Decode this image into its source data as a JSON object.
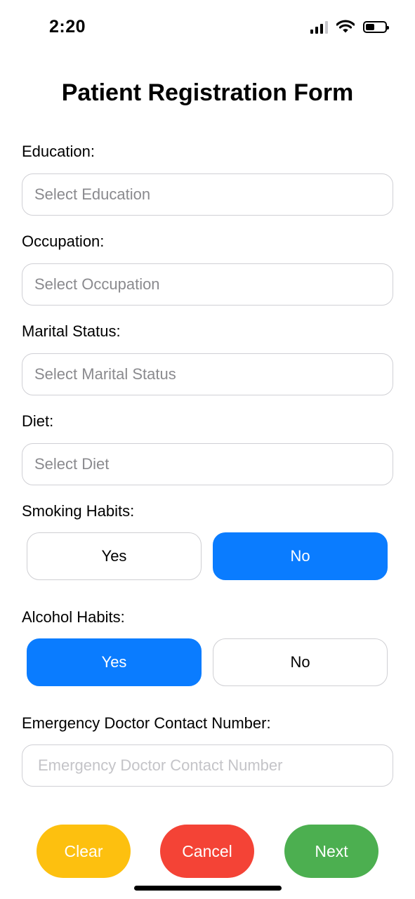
{
  "status_bar": {
    "time": "2:20"
  },
  "form": {
    "title": "Patient Registration Form",
    "education": {
      "label": "Education:",
      "placeholder": "Select Education"
    },
    "occupation": {
      "label": "Occupation:",
      "placeholder": "Select Occupation"
    },
    "marital_status": {
      "label": "Marital Status:",
      "placeholder": "Select Marital Status"
    },
    "diet": {
      "label": "Diet:",
      "placeholder": "Select Diet"
    },
    "smoking": {
      "label": "Smoking Habits:",
      "yes": "Yes",
      "no": "No",
      "selected": "No"
    },
    "alcohol": {
      "label": "Alcohol Habits:",
      "yes": "Yes",
      "no": "No",
      "selected": "Yes"
    },
    "emergency_contact": {
      "label": "Emergency Doctor Contact Number:",
      "placeholder": "Emergency Doctor Contact Number",
      "value": ""
    }
  },
  "actions": {
    "clear": "Clear",
    "cancel": "Cancel",
    "next": "Next"
  },
  "colors": {
    "accent": "#0a7cff",
    "clear": "#fdc00f",
    "cancel": "#f44336",
    "next": "#4caf50"
  }
}
